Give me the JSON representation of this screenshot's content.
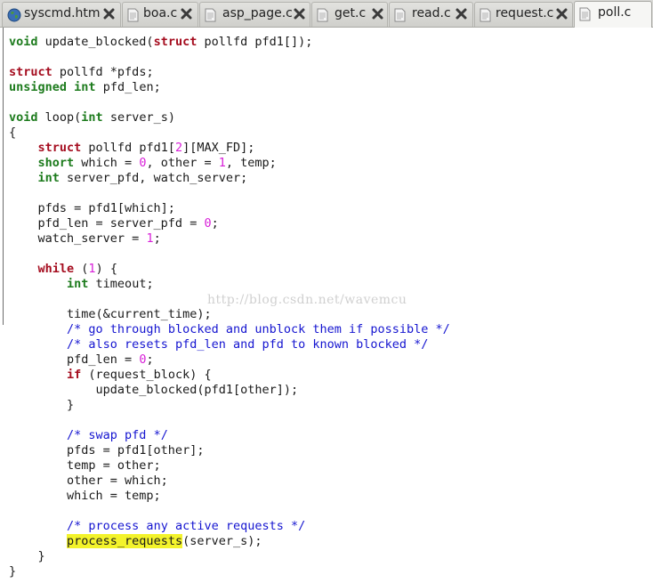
{
  "tabs": [
    {
      "label": "syscmd.htm",
      "icon": "globe-icon"
    },
    {
      "label": "boa.c",
      "icon": "document-icon"
    },
    {
      "label": "asp_page.c",
      "icon": "document-icon"
    },
    {
      "label": "get.c",
      "icon": "document-icon"
    },
    {
      "label": "read.c",
      "icon": "document-icon"
    },
    {
      "label": "request.c",
      "icon": "document-icon"
    },
    {
      "label": "poll.c",
      "icon": "document-icon",
      "active": true
    }
  ],
  "colors": {
    "keyword": "#a50d1f",
    "type": "#1d7b1d",
    "number": "#d81fd8",
    "comment": "#1515d0",
    "highlight": "#f3f32b",
    "close_icon": "#3a3a3a"
  },
  "watermark": "http://blog.csdn.net/wavemcu",
  "code": {
    "lines": [
      [
        {
          "t": "void",
          "c": "ty"
        },
        {
          "t": " update_blocked("
        },
        {
          "t": "struct",
          "c": "kw"
        },
        {
          "t": " pollfd pfd1[]);"
        }
      ],
      [],
      [
        {
          "t": "struct",
          "c": "kw"
        },
        {
          "t": " pollfd *pfds;"
        }
      ],
      [
        {
          "t": "unsigned",
          "c": "ty"
        },
        {
          "t": " "
        },
        {
          "t": "int",
          "c": "ty"
        },
        {
          "t": " pfd_len;"
        }
      ],
      [],
      [
        {
          "t": "void",
          "c": "ty"
        },
        {
          "t": " loop("
        },
        {
          "t": "int",
          "c": "ty"
        },
        {
          "t": " server_s)"
        }
      ],
      [
        {
          "t": "{"
        }
      ],
      [
        {
          "t": "    "
        },
        {
          "t": "struct",
          "c": "kw"
        },
        {
          "t": " pollfd pfd1["
        },
        {
          "t": "2",
          "c": "num"
        },
        {
          "t": "][MAX_FD];"
        }
      ],
      [
        {
          "t": "    "
        },
        {
          "t": "short",
          "c": "ty"
        },
        {
          "t": " which = "
        },
        {
          "t": "0",
          "c": "num"
        },
        {
          "t": ", other = "
        },
        {
          "t": "1",
          "c": "num"
        },
        {
          "t": ", temp;"
        }
      ],
      [
        {
          "t": "    "
        },
        {
          "t": "int",
          "c": "ty"
        },
        {
          "t": " server_pfd, watch_server;"
        }
      ],
      [],
      [
        {
          "t": "    pfds = pfd1[which];"
        }
      ],
      [
        {
          "t": "    pfd_len = server_pfd = "
        },
        {
          "t": "0",
          "c": "num"
        },
        {
          "t": ";"
        }
      ],
      [
        {
          "t": "    watch_server = "
        },
        {
          "t": "1",
          "c": "num"
        },
        {
          "t": ";"
        }
      ],
      [],
      [
        {
          "t": "    "
        },
        {
          "t": "while",
          "c": "kw"
        },
        {
          "t": " ("
        },
        {
          "t": "1",
          "c": "num"
        },
        {
          "t": ") {"
        }
      ],
      [
        {
          "t": "        "
        },
        {
          "t": "int",
          "c": "ty"
        },
        {
          "t": " timeout;"
        }
      ],
      [],
      [
        {
          "t": "        time(&current_time);"
        }
      ],
      [
        {
          "t": "        "
        },
        {
          "t": "/* go through blocked and unblock them if possible */",
          "c": "cm"
        }
      ],
      [
        {
          "t": "        "
        },
        {
          "t": "/* also resets pfd_len and pfd to known blocked */",
          "c": "cm"
        }
      ],
      [
        {
          "t": "        pfd_len = "
        },
        {
          "t": "0",
          "c": "num"
        },
        {
          "t": ";"
        }
      ],
      [
        {
          "t": "        "
        },
        {
          "t": "if",
          "c": "kw"
        },
        {
          "t": " (request_block) {"
        }
      ],
      [
        {
          "t": "            update_blocked(pfd1[other]);"
        }
      ],
      [
        {
          "t": "        }"
        }
      ],
      [],
      [
        {
          "t": "        "
        },
        {
          "t": "/* swap pfd */",
          "c": "cm"
        }
      ],
      [
        {
          "t": "        pfds = pfd1[other];"
        }
      ],
      [
        {
          "t": "        temp = other;"
        }
      ],
      [
        {
          "t": "        other = which;"
        }
      ],
      [
        {
          "t": "        which = temp;"
        }
      ],
      [],
      [
        {
          "t": "        "
        },
        {
          "t": "/* process any active requests */",
          "c": "cm"
        }
      ],
      [
        {
          "t": "        "
        },
        {
          "t": "process_requests",
          "c": "hl"
        },
        {
          "t": "(server_s);"
        }
      ],
      [
        {
          "t": "    }"
        }
      ],
      [
        {
          "t": "}"
        }
      ]
    ]
  }
}
